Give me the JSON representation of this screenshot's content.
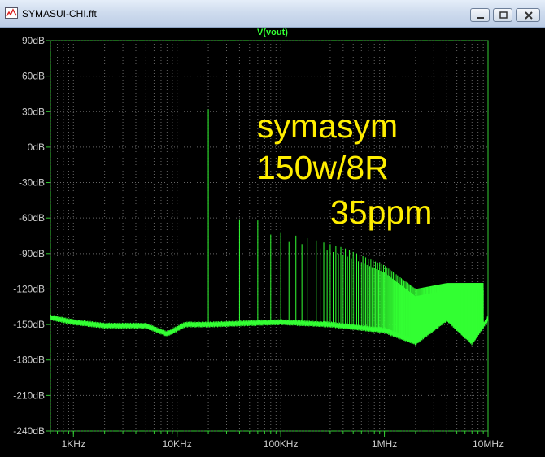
{
  "window": {
    "title": "SYMASUI-CHI.fft",
    "icon": "waveform-chart-icon",
    "controls": [
      "minimize-icon",
      "maximize-icon",
      "close-icon"
    ]
  },
  "colors": {
    "background": "#000000",
    "trace": "#33ff33",
    "axes": "#33cc33",
    "text_labels": "#cccccc",
    "annotation": "#ffee00"
  },
  "annotations": [
    "symasym",
    "150w/8R",
    "35ppm"
  ],
  "chart_data": {
    "type": "line",
    "title": "V(vout)",
    "xlabel": "",
    "ylabel": "",
    "x_scale": "log",
    "xlim": [
      600,
      10000000
    ],
    "ylim": [
      -240,
      90
    ],
    "grid": true,
    "x_tick_labels": [
      {
        "value": 1000,
        "label": "1KHz"
      },
      {
        "value": 10000,
        "label": "10KHz"
      },
      {
        "value": 100000,
        "label": "100KHz"
      },
      {
        "value": 1000000,
        "label": "1MHz"
      },
      {
        "value": 10000000,
        "label": "10MHz"
      }
    ],
    "y_tick_labels": [
      {
        "value": 90,
        "label": "90dB"
      },
      {
        "value": 60,
        "label": "60dB"
      },
      {
        "value": 30,
        "label": "30dB"
      },
      {
        "value": 0,
        "label": "0dB"
      },
      {
        "value": -30,
        "label": "-30dB"
      },
      {
        "value": -60,
        "label": "-60dB"
      },
      {
        "value": -90,
        "label": "-90dB"
      },
      {
        "value": -120,
        "label": "-120dB"
      },
      {
        "value": -150,
        "label": "-150dB"
      },
      {
        "value": -180,
        "label": "-180dB"
      },
      {
        "value": -210,
        "label": "-210dB"
      },
      {
        "value": -240,
        "label": "-240dB"
      }
    ],
    "series": [
      {
        "name": "V(vout)",
        "noise_floor": [
          {
            "x": 600,
            "y": -144
          },
          {
            "x": 1000,
            "y": -148
          },
          {
            "x": 2000,
            "y": -151
          },
          {
            "x": 5000,
            "y": -151
          },
          {
            "x": 8000,
            "y": -158
          },
          {
            "x": 12000,
            "y": -150
          },
          {
            "x": 20000,
            "y": -150
          },
          {
            "x": 100000,
            "y": -148
          },
          {
            "x": 300000,
            "y": -150
          },
          {
            "x": 1000000,
            "y": -155
          },
          {
            "x": 2000000,
            "y": -165
          },
          {
            "x": 4000000,
            "y": -145
          },
          {
            "x": 7000000,
            "y": -165
          },
          {
            "x": 10000000,
            "y": -145
          }
        ],
        "fundamental": {
          "x": 20000,
          "y": 32
        },
        "harmonics": [
          {
            "x": 40000,
            "y": -55
          },
          {
            "x": 60000,
            "y": -62
          },
          {
            "x": 80000,
            "y": -68
          },
          {
            "x": 100000,
            "y": -72
          },
          {
            "x": 200000,
            "y": -78
          },
          {
            "x": 400000,
            "y": -85
          },
          {
            "x": 1000000,
            "y": -100
          },
          {
            "x": 2000000,
            "y": -120
          },
          {
            "x": 4000000,
            "y": -115
          }
        ]
      }
    ]
  }
}
